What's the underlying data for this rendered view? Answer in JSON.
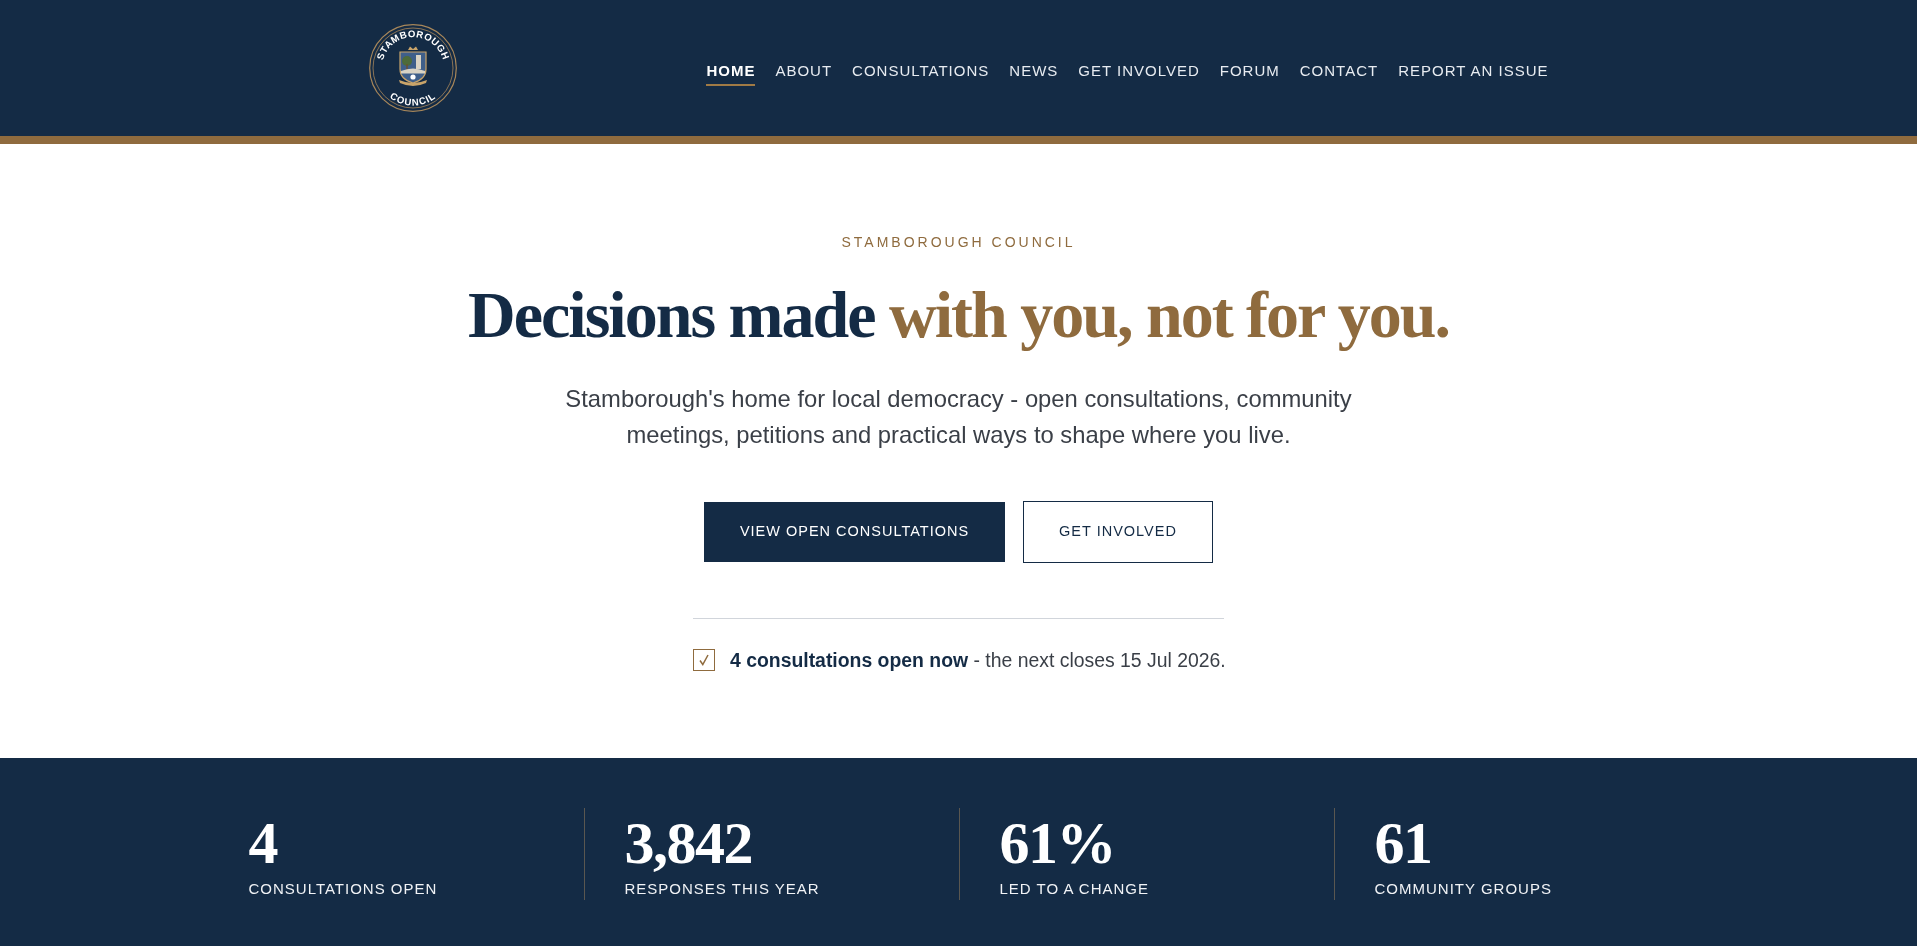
{
  "header": {
    "logo": {
      "top_text": "STAMBOROUGH",
      "bottom_text": "COUNCIL"
    },
    "nav": [
      {
        "label": "HOME",
        "selected": true
      },
      {
        "label": "ABOUT",
        "selected": false
      },
      {
        "label": "CONSULTATIONS",
        "selected": false
      },
      {
        "label": "NEWS",
        "selected": false
      },
      {
        "label": "GET INVOLVED",
        "selected": false
      },
      {
        "label": "FORUM",
        "selected": false
      },
      {
        "label": "CONTACT",
        "selected": false
      },
      {
        "label": "REPORT AN ISSUE",
        "selected": false
      }
    ]
  },
  "hero": {
    "eyebrow": "STAMBOROUGH COUNCIL",
    "headline": {
      "lead": "Decisions made",
      "accent": "with you, not for you."
    },
    "intro": "Stamborough's home for local democracy - open consultations, community meetings, petitions and practical ways to shape where you live.",
    "buttons": [
      {
        "label": "VIEW OPEN CONSULTATIONS",
        "kind": "primary"
      },
      {
        "label": "GET INVOLVED",
        "kind": "secondary"
      }
    ],
    "notice": "**4 consultations open now** - the next closes 15 Jul 2026."
  },
  "stats": [
    {
      "value": "4",
      "label": "CONSULTATIONS OPEN"
    },
    {
      "value": "3,842",
      "label": "RESPONSES THIS YEAR"
    },
    {
      "value": "61%",
      "label": "LED TO A CHANGE"
    },
    {
      "value": "61",
      "label": "COMMUNITY GROUPS"
    }
  ]
}
